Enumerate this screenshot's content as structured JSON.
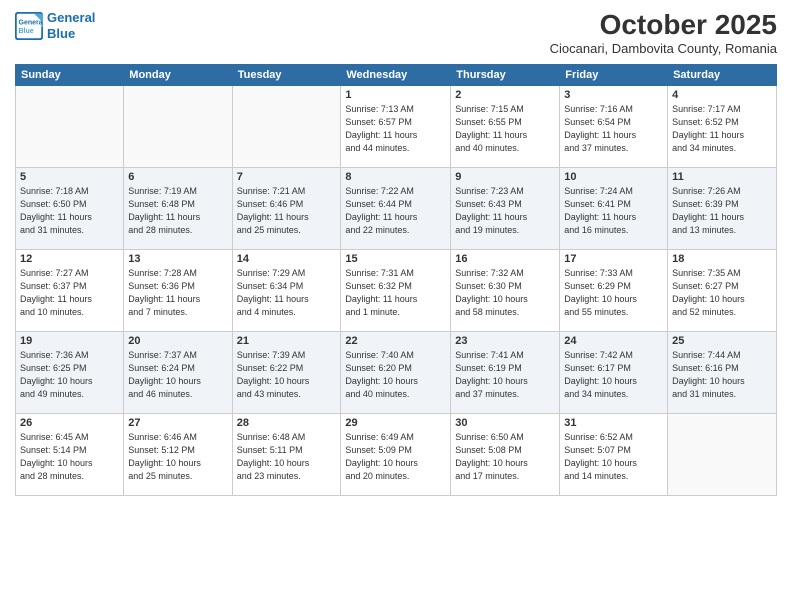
{
  "header": {
    "logo_line1": "General",
    "logo_line2": "Blue",
    "month": "October 2025",
    "location": "Ciocanari, Dambovita County, Romania"
  },
  "days_of_week": [
    "Sunday",
    "Monday",
    "Tuesday",
    "Wednesday",
    "Thursday",
    "Friday",
    "Saturday"
  ],
  "weeks": [
    [
      {
        "num": "",
        "info": ""
      },
      {
        "num": "",
        "info": ""
      },
      {
        "num": "",
        "info": ""
      },
      {
        "num": "1",
        "info": "Sunrise: 7:13 AM\nSunset: 6:57 PM\nDaylight: 11 hours\nand 44 minutes."
      },
      {
        "num": "2",
        "info": "Sunrise: 7:15 AM\nSunset: 6:55 PM\nDaylight: 11 hours\nand 40 minutes."
      },
      {
        "num": "3",
        "info": "Sunrise: 7:16 AM\nSunset: 6:54 PM\nDaylight: 11 hours\nand 37 minutes."
      },
      {
        "num": "4",
        "info": "Sunrise: 7:17 AM\nSunset: 6:52 PM\nDaylight: 11 hours\nand 34 minutes."
      }
    ],
    [
      {
        "num": "5",
        "info": "Sunrise: 7:18 AM\nSunset: 6:50 PM\nDaylight: 11 hours\nand 31 minutes."
      },
      {
        "num": "6",
        "info": "Sunrise: 7:19 AM\nSunset: 6:48 PM\nDaylight: 11 hours\nand 28 minutes."
      },
      {
        "num": "7",
        "info": "Sunrise: 7:21 AM\nSunset: 6:46 PM\nDaylight: 11 hours\nand 25 minutes."
      },
      {
        "num": "8",
        "info": "Sunrise: 7:22 AM\nSunset: 6:44 PM\nDaylight: 11 hours\nand 22 minutes."
      },
      {
        "num": "9",
        "info": "Sunrise: 7:23 AM\nSunset: 6:43 PM\nDaylight: 11 hours\nand 19 minutes."
      },
      {
        "num": "10",
        "info": "Sunrise: 7:24 AM\nSunset: 6:41 PM\nDaylight: 11 hours\nand 16 minutes."
      },
      {
        "num": "11",
        "info": "Sunrise: 7:26 AM\nSunset: 6:39 PM\nDaylight: 11 hours\nand 13 minutes."
      }
    ],
    [
      {
        "num": "12",
        "info": "Sunrise: 7:27 AM\nSunset: 6:37 PM\nDaylight: 11 hours\nand 10 minutes."
      },
      {
        "num": "13",
        "info": "Sunrise: 7:28 AM\nSunset: 6:36 PM\nDaylight: 11 hours\nand 7 minutes."
      },
      {
        "num": "14",
        "info": "Sunrise: 7:29 AM\nSunset: 6:34 PM\nDaylight: 11 hours\nand 4 minutes."
      },
      {
        "num": "15",
        "info": "Sunrise: 7:31 AM\nSunset: 6:32 PM\nDaylight: 11 hours\nand 1 minute."
      },
      {
        "num": "16",
        "info": "Sunrise: 7:32 AM\nSunset: 6:30 PM\nDaylight: 10 hours\nand 58 minutes."
      },
      {
        "num": "17",
        "info": "Sunrise: 7:33 AM\nSunset: 6:29 PM\nDaylight: 10 hours\nand 55 minutes."
      },
      {
        "num": "18",
        "info": "Sunrise: 7:35 AM\nSunset: 6:27 PM\nDaylight: 10 hours\nand 52 minutes."
      }
    ],
    [
      {
        "num": "19",
        "info": "Sunrise: 7:36 AM\nSunset: 6:25 PM\nDaylight: 10 hours\nand 49 minutes."
      },
      {
        "num": "20",
        "info": "Sunrise: 7:37 AM\nSunset: 6:24 PM\nDaylight: 10 hours\nand 46 minutes."
      },
      {
        "num": "21",
        "info": "Sunrise: 7:39 AM\nSunset: 6:22 PM\nDaylight: 10 hours\nand 43 minutes."
      },
      {
        "num": "22",
        "info": "Sunrise: 7:40 AM\nSunset: 6:20 PM\nDaylight: 10 hours\nand 40 minutes."
      },
      {
        "num": "23",
        "info": "Sunrise: 7:41 AM\nSunset: 6:19 PM\nDaylight: 10 hours\nand 37 minutes."
      },
      {
        "num": "24",
        "info": "Sunrise: 7:42 AM\nSunset: 6:17 PM\nDaylight: 10 hours\nand 34 minutes."
      },
      {
        "num": "25",
        "info": "Sunrise: 7:44 AM\nSunset: 6:16 PM\nDaylight: 10 hours\nand 31 minutes."
      }
    ],
    [
      {
        "num": "26",
        "info": "Sunrise: 6:45 AM\nSunset: 5:14 PM\nDaylight: 10 hours\nand 28 minutes."
      },
      {
        "num": "27",
        "info": "Sunrise: 6:46 AM\nSunset: 5:12 PM\nDaylight: 10 hours\nand 25 minutes."
      },
      {
        "num": "28",
        "info": "Sunrise: 6:48 AM\nSunset: 5:11 PM\nDaylight: 10 hours\nand 23 minutes."
      },
      {
        "num": "29",
        "info": "Sunrise: 6:49 AM\nSunset: 5:09 PM\nDaylight: 10 hours\nand 20 minutes."
      },
      {
        "num": "30",
        "info": "Sunrise: 6:50 AM\nSunset: 5:08 PM\nDaylight: 10 hours\nand 17 minutes."
      },
      {
        "num": "31",
        "info": "Sunrise: 6:52 AM\nSunset: 5:07 PM\nDaylight: 10 hours\nand 14 minutes."
      },
      {
        "num": "",
        "info": ""
      }
    ]
  ]
}
